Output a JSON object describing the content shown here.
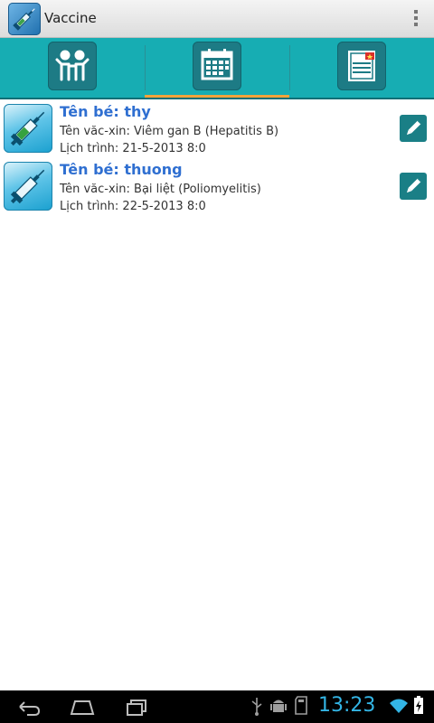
{
  "actionbar": {
    "title": "Vaccine",
    "app_icon": "syringe-app-icon",
    "overflow_icon": "overflow-menu-icon"
  },
  "tabs": [
    {
      "icon": "children-icon",
      "active": false
    },
    {
      "icon": "calendar-icon",
      "active": true
    },
    {
      "icon": "news-icon",
      "active": false
    }
  ],
  "colors": {
    "tabbar": "#17adb3",
    "tile": "#1d7b85",
    "active_underline": "#f3a33b",
    "name_text": "#2f6fd1",
    "clock": "#33b5e5"
  },
  "schedule": [
    {
      "name": "Tên bé: thy",
      "vaccine": "Tên văc-xin: Viêm gan B (Hepatitis B)",
      "schedule": "Lịch trình: 21-5-2013 8:0",
      "icon": "syringe-icon",
      "edit_icon": "pencil-icon"
    },
    {
      "name": "Tên bé: thuong",
      "vaccine": "Tên văc-xin: Bại liệt (Poliomyelitis)",
      "schedule": "Lịch trình: 22-5-2013 8:0",
      "icon": "syringe-icon",
      "edit_icon": "pencil-icon"
    }
  ],
  "statusbar": {
    "time": "13:23",
    "icons": [
      "usb-icon",
      "android-debug-icon",
      "sd-card-icon",
      "wifi-icon",
      "battery-charging-icon"
    ]
  },
  "navbar": {
    "icons": [
      "back-icon",
      "home-icon",
      "recent-apps-icon"
    ]
  }
}
